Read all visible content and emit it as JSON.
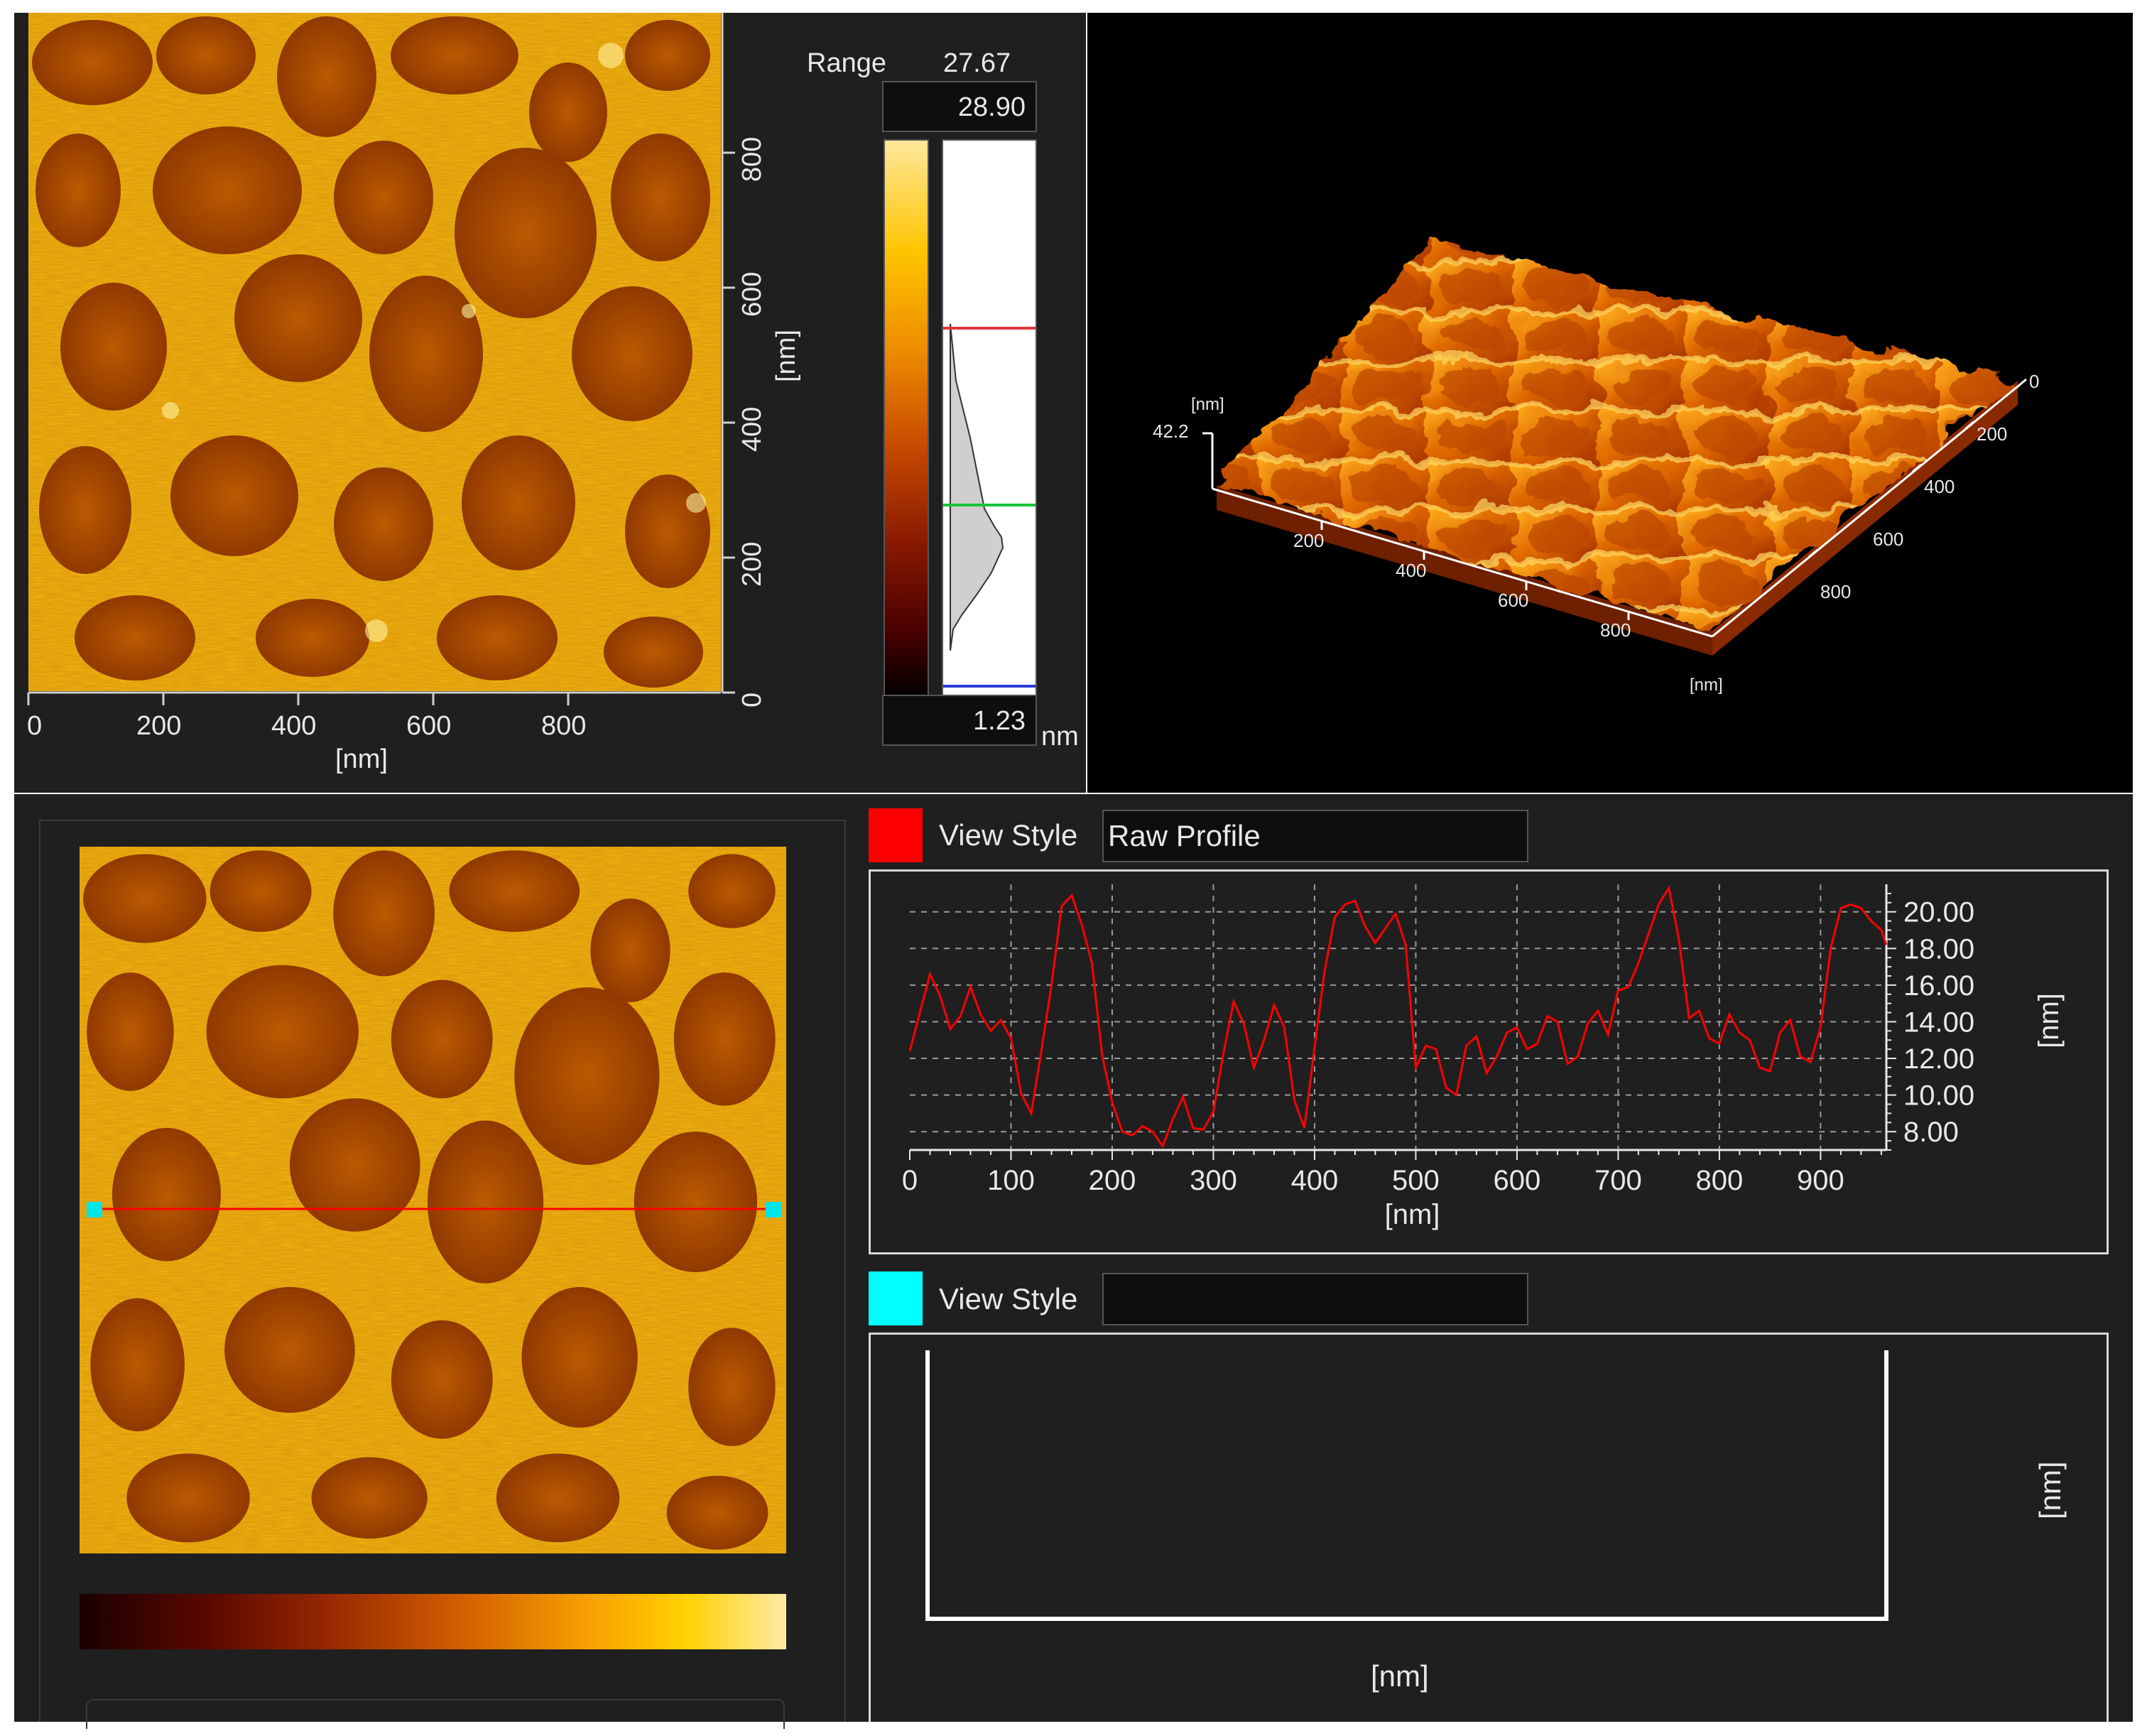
{
  "colors": {
    "accent_red": "#ff0000",
    "accent_cyan": "#00ffff",
    "panel_bg": "#1f1f1f",
    "plot_bg": "#000000"
  },
  "afm_image": {
    "x_ticks": [
      "0",
      "200",
      "400",
      "600",
      "800"
    ],
    "y_ticks": [
      "0",
      "200",
      "400",
      "600",
      "800"
    ],
    "x_unit": "[nm]",
    "y_unit": "[nm]"
  },
  "range_panel": {
    "label": "Range",
    "range_value": "27.67",
    "max_value": "28.90",
    "min_value": "1.23",
    "unit": "nm"
  },
  "view3d": {
    "z_unit": "[nm]",
    "z_value": "42.2",
    "x_ticks": [
      "200",
      "400",
      "600",
      "800"
    ],
    "y_ticks": [
      "0",
      "200",
      "400",
      "600",
      "800"
    ],
    "x_unit": "[nm]"
  },
  "profile1": {
    "swatch_color": "#ff0000",
    "view_style_label": "View Style",
    "view_style_value": "Raw Profile"
  },
  "profile2": {
    "swatch_color": "#00ffff",
    "view_style_label": "View Style",
    "view_style_value": "",
    "y_unit": "[nm]",
    "x_unit": "[nm]"
  },
  "chart_data": {
    "type": "line",
    "title": "",
    "xlabel": "[nm]",
    "ylabel": "[nm]",
    "xlim": [
      0,
      965
    ],
    "ylim": [
      7,
      21.5
    ],
    "x_ticks": [
      "0",
      "100",
      "200",
      "300",
      "400",
      "500",
      "600",
      "700",
      "800",
      "900"
    ],
    "y_ticks": [
      "8.00",
      "10.00",
      "12.00",
      "14.00",
      "16.00",
      "18.00",
      "20.00"
    ],
    "grid": true,
    "series": [
      {
        "color": "#ff0000",
        "x": [
          0,
          10,
          20,
          30,
          40,
          50,
          60,
          70,
          80,
          90,
          100,
          110,
          120,
          130,
          140,
          150,
          160,
          170,
          180,
          190,
          200,
          210,
          220,
          230,
          240,
          250,
          260,
          270,
          280,
          290,
          300,
          310,
          320,
          330,
          340,
          350,
          360,
          370,
          380,
          390,
          400,
          410,
          420,
          430,
          440,
          450,
          460,
          470,
          480,
          490,
          500,
          510,
          520,
          530,
          540,
          550,
          560,
          570,
          580,
          590,
          600,
          610,
          620,
          630,
          640,
          650,
          660,
          670,
          680,
          690,
          700,
          710,
          720,
          730,
          740,
          750,
          760,
          770,
          780,
          790,
          800,
          810,
          820,
          830,
          840,
          850,
          860,
          870,
          880,
          890,
          900,
          910,
          920,
          930,
          940,
          950,
          960,
          965
        ],
        "values": [
          12.4,
          14.5,
          16.6,
          15.4,
          13.6,
          14.3,
          15.9,
          14.4,
          13.5,
          14.1,
          13.1,
          10.1,
          9.0,
          12.4,
          16.0,
          20.3,
          20.9,
          19.3,
          17.2,
          12.2,
          9.6,
          8.0,
          7.8,
          8.3,
          8.0,
          7.2,
          8.7,
          9.9,
          8.2,
          8.1,
          9.1,
          12.3,
          15.1,
          13.9,
          11.5,
          13.0,
          14.9,
          13.7,
          9.7,
          8.2,
          12.6,
          16.8,
          19.7,
          20.4,
          20.6,
          19.2,
          18.3,
          19.1,
          19.9,
          18.2,
          11.5,
          12.7,
          12.5,
          10.4,
          10.0,
          12.7,
          13.2,
          11.2,
          12.1,
          13.4,
          13.7,
          12.5,
          12.8,
          14.3,
          14.0,
          11.7,
          12.1,
          13.9,
          14.6,
          13.3,
          15.7,
          15.9,
          17.2,
          18.8,
          20.4,
          21.3,
          18.5,
          14.2,
          14.6,
          13.1,
          12.8,
          14.4,
          13.4,
          13.0,
          11.5,
          11.3,
          13.4,
          14.1,
          12.1,
          11.8,
          13.7,
          18.0,
          20.2,
          20.4,
          20.2,
          19.5,
          19.0,
          18.2
        ]
      }
    ]
  }
}
